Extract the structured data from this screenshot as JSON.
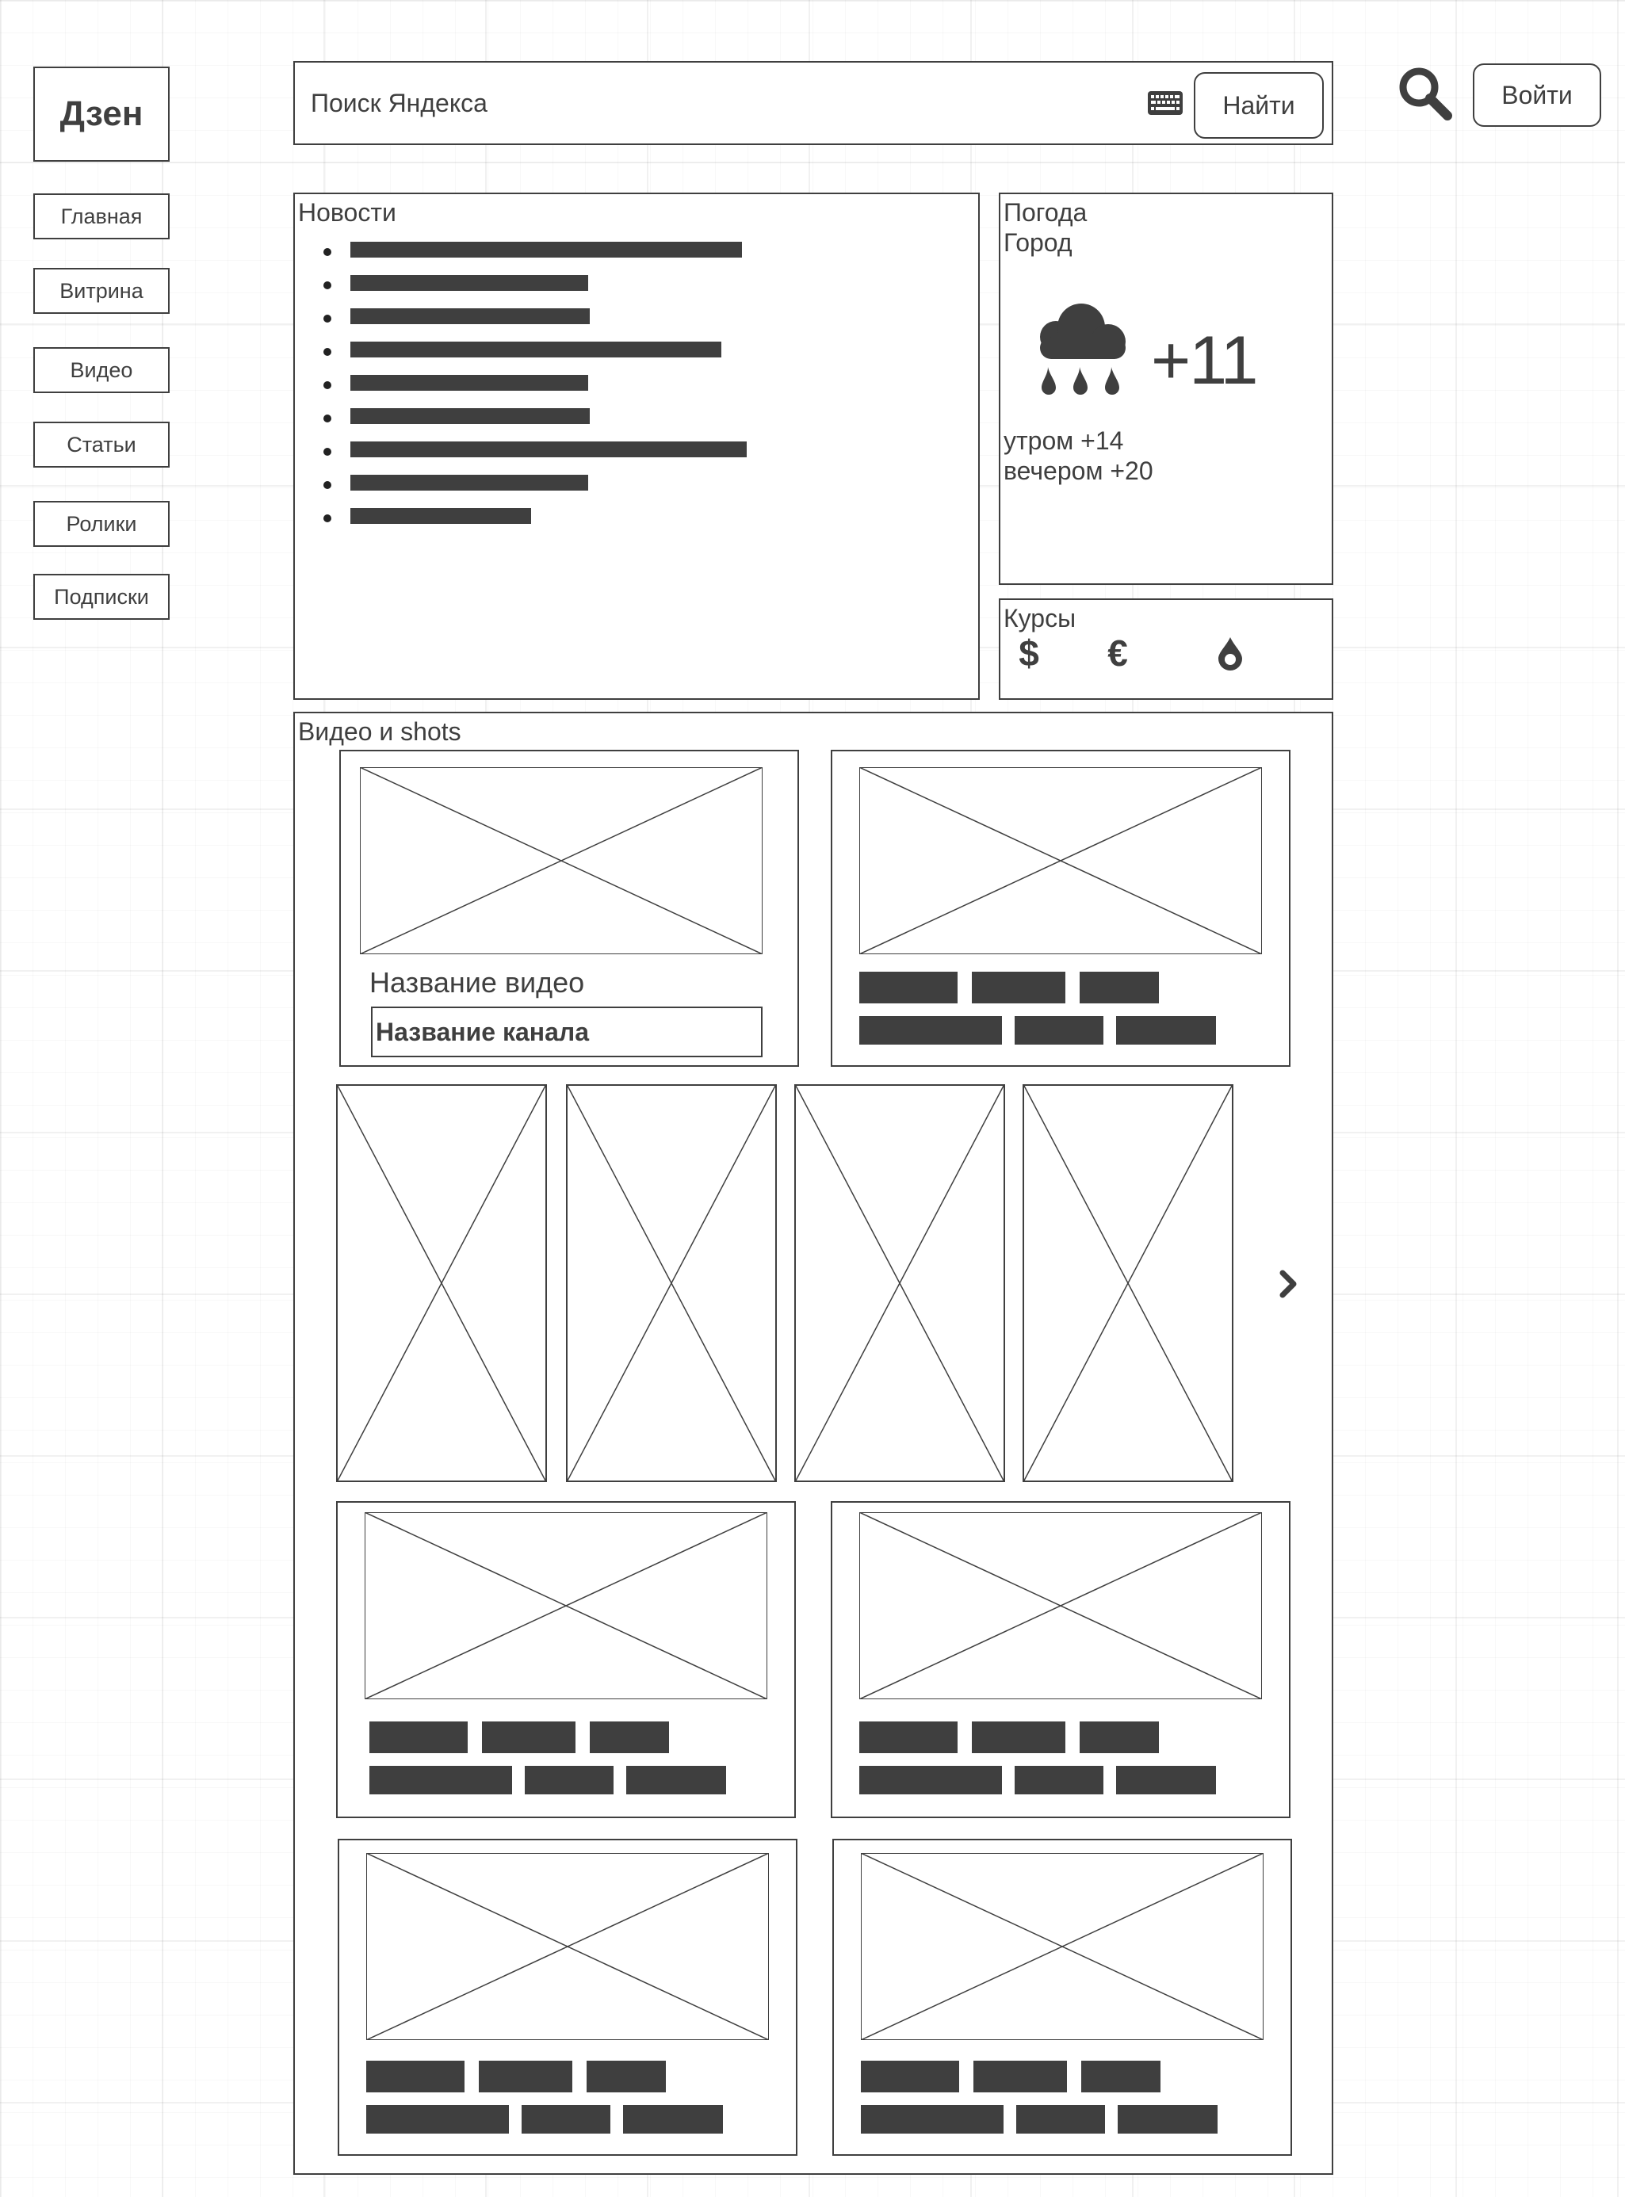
{
  "logo": "Дзен",
  "nav": [
    "Главная",
    "Витрина",
    "Видео",
    "Статьи",
    "Ролики",
    "Подписки"
  ],
  "search": {
    "placeholder": "Поиск Яндекса",
    "button": "Найти"
  },
  "header": {
    "login": "Войти"
  },
  "news": {
    "title": "Новости",
    "items": 9
  },
  "weather": {
    "title": "Погода",
    "city": "Город",
    "temp": "+11",
    "morning": "утром +14",
    "evening": "вечером +20",
    "icon": "cloud-rain-icon"
  },
  "rates": {
    "title": "Курсы",
    "icons": [
      "dollar-icon",
      "euro-icon",
      "oil-drop-icon"
    ]
  },
  "video": {
    "title": "Видео и shots",
    "video_title": "Название видео",
    "channel_name": "Название канала",
    "icons": [
      "chevron-right-icon"
    ]
  },
  "colors": {
    "ink": "#3f3f3f",
    "background": "#ffffff",
    "grid": "#e6e6e6"
  }
}
